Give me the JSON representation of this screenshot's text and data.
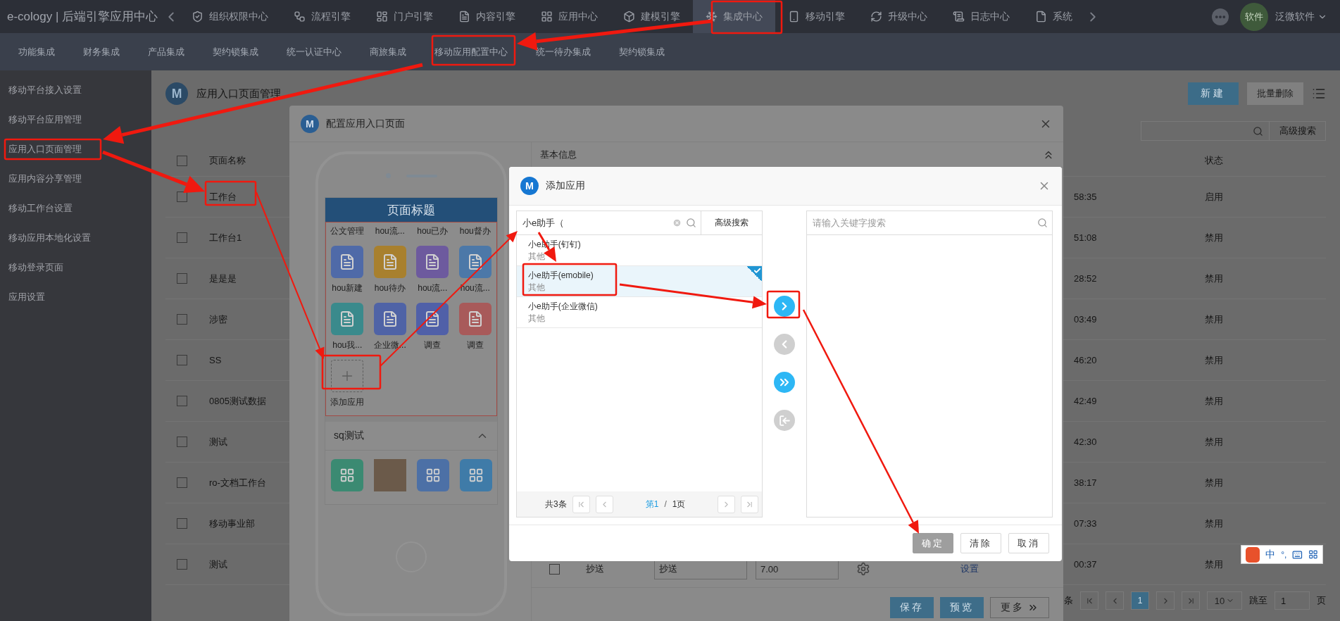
{
  "top_bar": {
    "app_title": "e-cology | 后端引擎应用中心",
    "nav": [
      {
        "label": "组织权限中心",
        "selected": false
      },
      {
        "label": "流程引擎",
        "selected": false
      },
      {
        "label": "门户引擎",
        "selected": false
      },
      {
        "label": "内容引擎",
        "selected": false
      },
      {
        "label": "应用中心",
        "selected": false
      },
      {
        "label": "建模引擎",
        "selected": false
      },
      {
        "label": "集成中心",
        "selected": true
      },
      {
        "label": "移动引擎",
        "selected": false
      },
      {
        "label": "升级中心",
        "selected": false
      },
      {
        "label": "日志中心",
        "selected": false
      },
      {
        "label": "系统",
        "selected": false
      }
    ],
    "avatar": "软件",
    "user": "泛微软件"
  },
  "sub_nav": [
    "功能集成",
    "财务集成",
    "产品集成",
    "契约锁集成",
    "统一认证中心",
    "商旅集成",
    "移动应用配置中心",
    "统一待办集成",
    "契约锁集成"
  ],
  "sidebar": [
    "移动平台接入设置",
    "移动平台应用管理",
    "应用入口页面管理",
    "应用内容分享管理",
    "移动工作台设置",
    "移动应用本地化设置",
    "移动登录页面",
    "应用设置"
  ],
  "page": {
    "logo": "M",
    "title": "应用入口页面管理",
    "buttons": [
      "新建",
      "批量删除"
    ],
    "advanced_search": "高级搜索",
    "columns": {
      "checked": false,
      "name": "页面名称",
      "status": "状态"
    },
    "rows": [
      {
        "checked": false,
        "name": "工作台",
        "time": "58:35",
        "status": "启用"
      },
      {
        "checked": false,
        "name": "工作台1",
        "time": "51:08",
        "status": "禁用"
      },
      {
        "checked": false,
        "name": "是是是",
        "time": "28:52",
        "status": "禁用"
      },
      {
        "checked": false,
        "name": "涉密",
        "time": "03:49",
        "status": "禁用"
      },
      {
        "checked": false,
        "name": "SS",
        "time": "46:20",
        "status": "禁用"
      },
      {
        "checked": false,
        "name": "0805测试数据",
        "time": "42:49",
        "status": "禁用"
      },
      {
        "checked": false,
        "name": "测试",
        "time": "42:30",
        "status": "禁用"
      },
      {
        "checked": false,
        "name": "ro-文档工作台",
        "time": "38:17",
        "status": "禁用"
      },
      {
        "checked": false,
        "name": "移动事业部",
        "time": "07:33",
        "status": "禁用"
      },
      {
        "checked": false,
        "name": "测试",
        "time": "00:37",
        "status": "禁用"
      }
    ],
    "pagination": {
      "total_suffix": "条",
      "current": "1",
      "page_size": "10",
      "jump_label": "跳至",
      "jump_value": "1",
      "page_suffix": "页"
    }
  },
  "config_dialog": {
    "logo": "M",
    "title": "配置应用入口页面",
    "phone": {
      "page_title": "页面标题",
      "top_labels": [
        "公文管理",
        "hou流...",
        "hou已办",
        "hou督办"
      ],
      "apps": [
        {
          "kind": "app",
          "label": "hou新建",
          "color": "#4f6aa8"
        },
        {
          "kind": "app",
          "label": "hou待办",
          "color": "#a8802e"
        },
        {
          "kind": "app",
          "label": "hou流...",
          "color": "#6d5a9e"
        },
        {
          "kind": "app",
          "label": "hou流...",
          "color": "#4c78a8"
        },
        {
          "kind": "app",
          "label": "hou我...",
          "color": "#3a8a8c"
        },
        {
          "kind": "app",
          "label": "企业微...",
          "color": "#4f63a6"
        },
        {
          "kind": "app",
          "label": "调查",
          "color": "#5060a8"
        },
        {
          "kind": "app",
          "label": "调查",
          "color": "#a85a5a"
        },
        {
          "kind": "add",
          "label": "添加应用"
        }
      ],
      "section": {
        "title": "sq测试",
        "expanded": true,
        "apps": [
          {
            "kind": "app",
            "color": "#3b8a72"
          },
          {
            "kind": "photo"
          },
          {
            "kind": "app",
            "color": "#4c70a6"
          },
          {
            "kind": "app",
            "color": "#3f7ba8"
          }
        ]
      }
    },
    "basic_info": "基本信息",
    "row": {
      "checked": false,
      "name": "抄送",
      "field": "抄送",
      "number": "7.00",
      "link": "设置"
    },
    "buttons": [
      "保存",
      "预览",
      "更多"
    ]
  },
  "add_dialog": {
    "logo": "M",
    "title": "添加应用",
    "search": {
      "value": "小e助手（",
      "advanced": "高级搜索"
    },
    "items": [
      {
        "name": "小e助手(钉钉)",
        "category": "其他",
        "selected": false
      },
      {
        "name": "小e助手(emobile)",
        "category": "其他",
        "selected": true
      },
      {
        "name": "小e助手(企业微信)",
        "category": "其他",
        "selected": false
      }
    ],
    "pager": {
      "total": "共3条",
      "current": "第1",
      "separator": "/",
      "pages": "1页"
    },
    "target_search": {
      "placeholder": "请输入关键字搜索"
    },
    "transfer": [
      {
        "kind": "right",
        "enabled": true
      },
      {
        "kind": "left",
        "enabled": false
      },
      {
        "kind": "all_right",
        "enabled": true
      },
      {
        "kind": "all_left",
        "enabled": false
      }
    ],
    "buttons": [
      {
        "label": "确定",
        "disabled": true
      },
      {
        "label": "清除",
        "disabled": false
      },
      {
        "label": "取消",
        "disabled": false
      }
    ]
  },
  "ime": {
    "mode": "中",
    "punct": "°,"
  }
}
